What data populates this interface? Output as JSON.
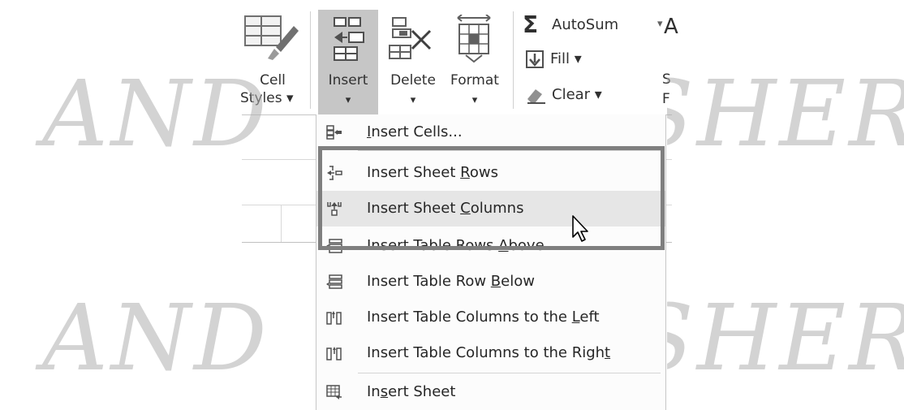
{
  "ribbon": {
    "cell_styles": {
      "line1": "Cell",
      "line2": "Styles ▾"
    },
    "insert": {
      "label": "Insert",
      "arrow": "▾"
    },
    "delete": {
      "label": "Delete",
      "arrow": "▾"
    },
    "format": {
      "label": "Format",
      "arrow": "▾"
    },
    "autosum": {
      "sigma": "Σ",
      "label": "AutoSum",
      "arrow": "▾"
    },
    "fill": {
      "label": "Fill ▾"
    },
    "clear": {
      "label": "Clear ▾"
    },
    "sort_partial": {
      "line1": "S",
      "line2": "F"
    }
  },
  "menu": {
    "items": [
      {
        "pre": "",
        "u": "I",
        "post": "nsert Cells...",
        "icon": "insert-cells-icon"
      },
      {
        "pre": "Insert Sheet ",
        "u": "R",
        "post": "ows",
        "icon": "insert-sheet-rows-icon"
      },
      {
        "pre": "Insert Sheet ",
        "u": "C",
        "post": "olumns",
        "icon": "insert-sheet-columns-icon"
      },
      {
        "pre": "Insert Table Rows ",
        "u": "A",
        "post": "bove",
        "icon": "insert-table-rows-above-icon"
      },
      {
        "pre": "Insert Table Row ",
        "u": "B",
        "post": "elow",
        "icon": "insert-table-row-below-icon"
      },
      {
        "pre": "Insert Table Columns to the ",
        "u": "L",
        "post": "eft",
        "icon": "insert-table-columns-left-icon"
      },
      {
        "pre": "Insert Table Columns to the Righ",
        "u": "t",
        "post": "",
        "icon": "insert-table-columns-right-icon"
      },
      {
        "pre": "In",
        "u": "s",
        "post": "ert Sheet",
        "icon": "insert-sheet-icon"
      }
    ]
  },
  "watermark": {
    "left": "AND",
    "right": "SHER"
  },
  "colors": {
    "highlight_box": "#7f7f7f",
    "selected_ribbon": "#c6c6c6",
    "hover_item": "#e6e6e6"
  }
}
